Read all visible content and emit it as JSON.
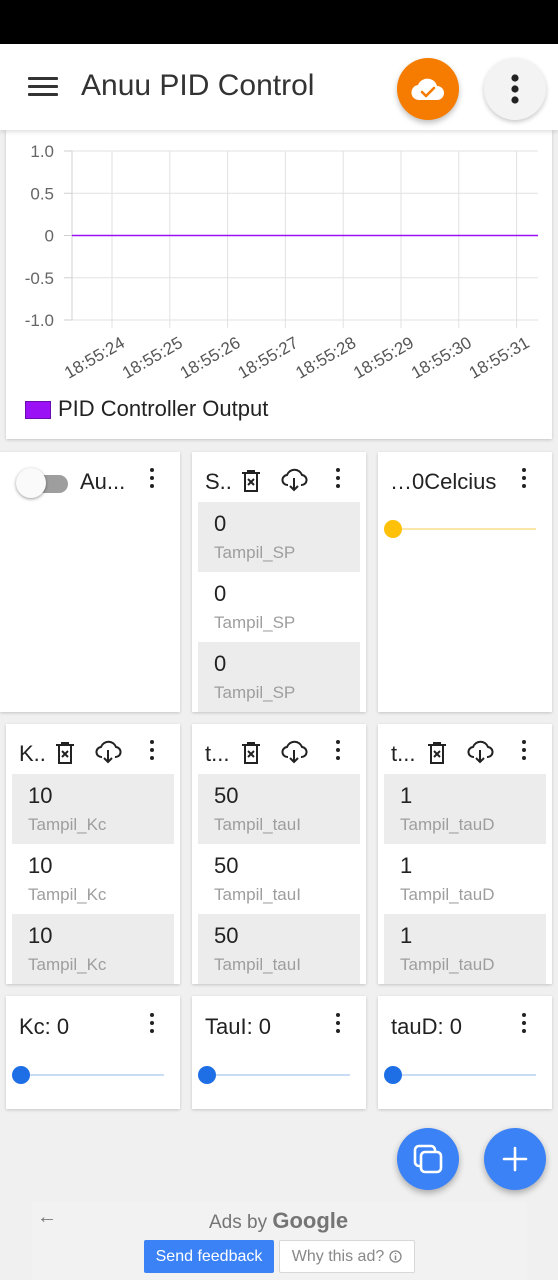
{
  "app": {
    "title": "Anuu PID Control"
  },
  "colors": {
    "accent_orange": "#f57c00",
    "accent_blue": "#3b82f6",
    "series_purple": "#9a11f5",
    "slider_yellow": "#ffc107",
    "slider_blue": "#1e6fe6"
  },
  "chart_data": {
    "type": "line",
    "x": [
      "18:55:24",
      "18:55:25",
      "18:55:26",
      "18:55:27",
      "18:55:28",
      "18:55:29",
      "18:55:30",
      "18:55:31"
    ],
    "series": [
      {
        "name": "PID Controller Output",
        "values": [
          0,
          0,
          0,
          0,
          0,
          0,
          0,
          0
        ],
        "color": "#9a11f5"
      }
    ],
    "y_ticks": [
      "1.0",
      "0.5",
      "0",
      "-0.5",
      "-1.0"
    ],
    "ylim": [
      -1.0,
      1.0
    ],
    "grid": true,
    "legend": "bottom-left"
  },
  "widgets": {
    "auto": {
      "title": "Au...",
      "toggle_on": false
    },
    "sp": {
      "title": "S..",
      "rows": [
        {
          "value": "0",
          "label": "Tampil_SP"
        },
        {
          "value": "0",
          "label": "Tampil_SP"
        },
        {
          "value": "0",
          "label": "Tampil_SP"
        }
      ]
    },
    "celcius": {
      "title": "…0Celcius",
      "slider_value": 0
    },
    "kc_log": {
      "title": "K..",
      "rows": [
        {
          "value": "10",
          "label": "Tampil_Kc"
        },
        {
          "value": "10",
          "label": "Tampil_Kc"
        },
        {
          "value": "10",
          "label": "Tampil_Kc"
        }
      ]
    },
    "taui_log": {
      "title": "t...",
      "rows": [
        {
          "value": "50",
          "label": "Tampil_tauI"
        },
        {
          "value": "50",
          "label": "Tampil_tauI"
        },
        {
          "value": "50",
          "label": "Tampil_tauI"
        }
      ]
    },
    "taud_log": {
      "title": "t...",
      "rows": [
        {
          "value": "1",
          "label": "Tampil_tauD"
        },
        {
          "value": "1",
          "label": "Tampil_tauD"
        },
        {
          "value": "1",
          "label": "Tampil_tauD"
        }
      ]
    },
    "kc_slider": {
      "title": "Kc: 0",
      "slider_value": 0
    },
    "taui_slider": {
      "title": "TauI: 0",
      "slider_value": 0
    },
    "taud_slider": {
      "title": "tauD: 0",
      "slider_value": 0
    }
  },
  "icons": {
    "menu": "menu-icon",
    "cloud": "cloud-check-icon",
    "more": "more-vert-icon",
    "trash": "delete-icon",
    "download": "cloud-download-icon",
    "copy": "copy-icon",
    "add": "add-icon"
  },
  "ad": {
    "label": "Ads by",
    "brand": "Google",
    "feedback": "Send feedback",
    "why": "Why this ad?"
  }
}
